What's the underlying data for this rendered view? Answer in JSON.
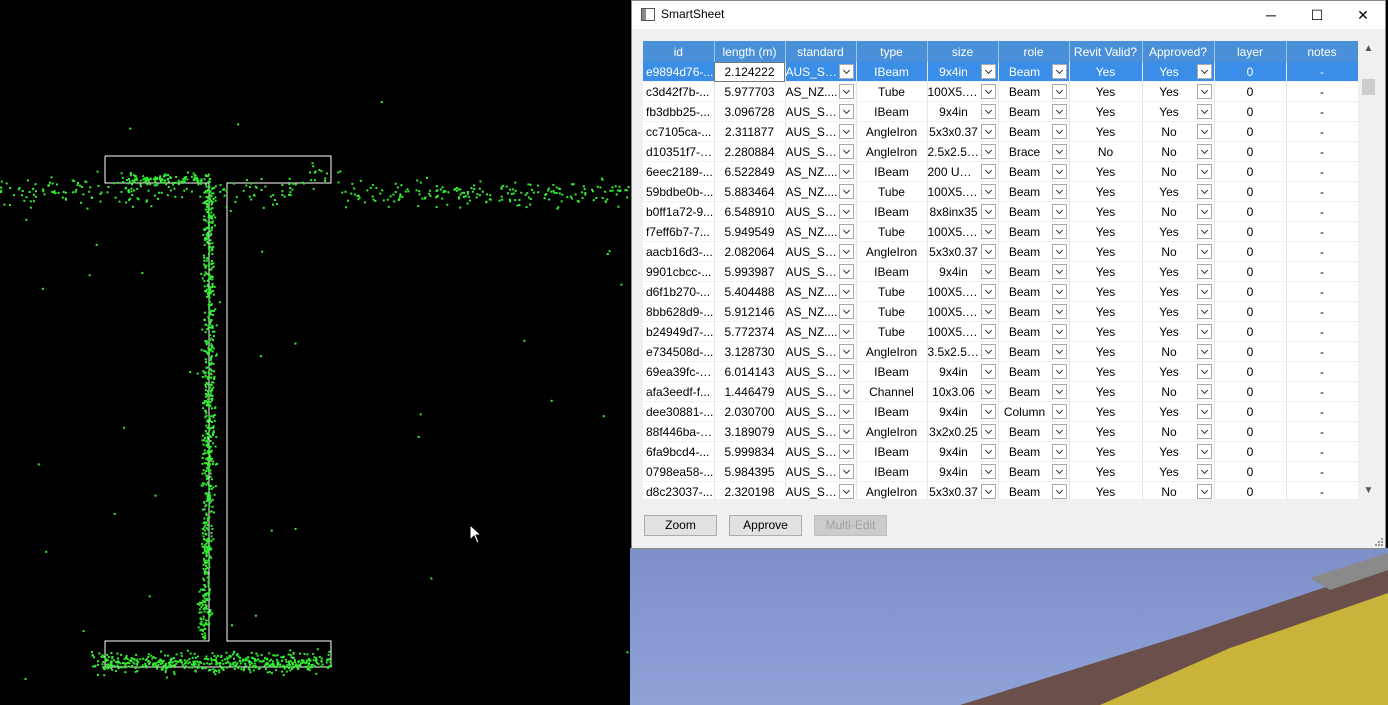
{
  "window": {
    "title": "SmartSheet",
    "minimize_glyph": "─",
    "maximize_glyph": "☐",
    "close_glyph": "✕"
  },
  "table": {
    "columns": [
      "id",
      "length (m)",
      "standard",
      "type",
      "size",
      "role",
      "Revit Valid?",
      "Approved?",
      "layer",
      "notes"
    ],
    "rows": [
      [
        "e9894d76-...",
        "2.124222",
        "AUS_ST...",
        "IBeam",
        "9x4in",
        "Beam",
        "Yes",
        "Yes",
        "0",
        "-"
      ],
      [
        "c3d42f7b-...",
        "5.977703",
        "AS_NZ....",
        "Tube",
        "100X5.0...",
        "Beam",
        "Yes",
        "Yes",
        "0",
        "-"
      ],
      [
        "fb3dbb25-...",
        "3.096728",
        "AUS_ST...",
        "IBeam",
        "9x4in",
        "Beam",
        "Yes",
        "Yes",
        "0",
        "-"
      ],
      [
        "cc7105ca-...",
        "2.311877",
        "AUS_ST...",
        "AngleIron",
        "5x3x0.37",
        "Beam",
        "Yes",
        "No",
        "0",
        "-"
      ],
      [
        "d10351f7-7...",
        "2.280884",
        "AUS_ST...",
        "AngleIron",
        "2.5x2.5x...",
        "Brace",
        "No",
        "No",
        "0",
        "-"
      ],
      [
        "6eec2189-...",
        "6.522849",
        "AS_NZ....",
        "IBeam",
        "200 UB ...",
        "Beam",
        "Yes",
        "No",
        "0",
        "-"
      ],
      [
        "59bdbe0b-...",
        "5.883464",
        "AS_NZ....",
        "Tube",
        "100X5.0...",
        "Beam",
        "Yes",
        "Yes",
        "0",
        "-"
      ],
      [
        "b0ff1a72-9...",
        "6.548910",
        "AUS_ST...",
        "IBeam",
        "8x8inx35",
        "Beam",
        "Yes",
        "No",
        "0",
        "-"
      ],
      [
        "f7eff6b7-7...",
        "5.949549",
        "AS_NZ....",
        "Tube",
        "100X5.0...",
        "Beam",
        "Yes",
        "Yes",
        "0",
        "-"
      ],
      [
        "aacb16d3-...",
        "2.082064",
        "AUS_ST...",
        "AngleIron",
        "5x3x0.37",
        "Beam",
        "Yes",
        "No",
        "0",
        "-"
      ],
      [
        "9901cbcc-...",
        "5.993987",
        "AUS_ST...",
        "IBeam",
        "9x4in",
        "Beam",
        "Yes",
        "Yes",
        "0",
        "-"
      ],
      [
        "d6f1b270-...",
        "5.404488",
        "AS_NZ....",
        "Tube",
        "100X5.0...",
        "Beam",
        "Yes",
        "Yes",
        "0",
        "-"
      ],
      [
        "8bb628d9-...",
        "5.912146",
        "AS_NZ....",
        "Tube",
        "100X5.0...",
        "Beam",
        "Yes",
        "Yes",
        "0",
        "-"
      ],
      [
        "b24949d7-...",
        "5.772374",
        "AS_NZ....",
        "Tube",
        "100X5.0...",
        "Beam",
        "Yes",
        "Yes",
        "0",
        "-"
      ],
      [
        "e734508d-...",
        "3.128730",
        "AUS_ST...",
        "AngleIron",
        "3.5x2.5x...",
        "Beam",
        "Yes",
        "No",
        "0",
        "-"
      ],
      [
        "69ea39fc-5...",
        "6.014143",
        "AUS_ST...",
        "IBeam",
        "9x4in",
        "Beam",
        "Yes",
        "Yes",
        "0",
        "-"
      ],
      [
        "afa3eedf-f...",
        "1.446479",
        "AUS_ST...",
        "Channel",
        "10x3.06",
        "Beam",
        "Yes",
        "No",
        "0",
        "-"
      ],
      [
        "dee30881-...",
        "2.030700",
        "AUS_ST...",
        "IBeam",
        "9x4in",
        "Column",
        "Yes",
        "Yes",
        "0",
        "-"
      ],
      [
        "88f446ba-0...",
        "3.189079",
        "AUS_ST...",
        "AngleIron",
        "3x2x0.25",
        "Beam",
        "Yes",
        "No",
        "0",
        "-"
      ],
      [
        "6fa9bcd4-...",
        "5.999834",
        "AUS_ST...",
        "IBeam",
        "9x4in",
        "Beam",
        "Yes",
        "Yes",
        "0",
        "-"
      ],
      [
        "0798ea58-...",
        "5.984395",
        "AUS_ST...",
        "IBeam",
        "9x4in",
        "Beam",
        "Yes",
        "Yes",
        "0",
        "-"
      ],
      [
        "d8c23037-...",
        "2.320198",
        "AUS_ST...",
        "AngleIron",
        "5x3x0.37",
        "Beam",
        "Yes",
        "No",
        "0",
        "-"
      ]
    ]
  },
  "buttons": {
    "zoom": "Zoom",
    "approve": "Approve",
    "multi_edit": "Multi-Edit"
  },
  "colors": {
    "header_blue": "#4a90d9",
    "selection_blue": "#3b8ee8",
    "point_green": "#33ee33",
    "viewport_bg": "#000000"
  }
}
